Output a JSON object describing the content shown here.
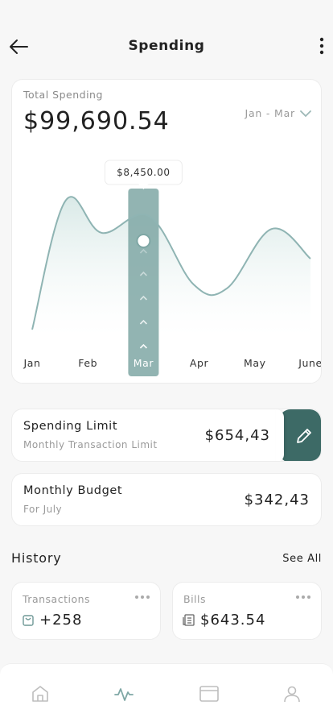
{
  "header": {
    "title": "Spending"
  },
  "summary": {
    "label": "Total Spending",
    "value": "$99,690.54",
    "range": "Jan - Mar"
  },
  "chart_data": {
    "type": "area",
    "categories": [
      "Jan",
      "Feb",
      "Mar",
      "Apr",
      "May",
      "June"
    ],
    "x_index": [
      0,
      0.6,
      1.25,
      2.1,
      2.9,
      3.5,
      4.3,
      5.0
    ],
    "values": [
      0.0,
      1.0,
      0.75,
      0.88,
      0.35,
      0.32,
      0.78,
      0.55
    ],
    "highlight": {
      "category": "Mar",
      "label": "$8,450.00"
    },
    "colors": {
      "line": "#8fb4b3",
      "fill": "#e3efee",
      "highlight": "#7fa7a5"
    }
  },
  "spending_limit": {
    "title": "Spending Limit",
    "subtitle": "Monthly Transaction Limit",
    "amount": "$654,43"
  },
  "monthly_budget": {
    "title": "Monthly Budget",
    "subtitle": "For July",
    "amount": "$342,43"
  },
  "history": {
    "title": "History",
    "see_all": "See All",
    "cards": [
      {
        "label": "Transactions",
        "value": "+258",
        "icon": "bag-icon"
      },
      {
        "label": "Bills",
        "value": "$643.54",
        "icon": "receipt-icon"
      }
    ]
  },
  "tabbar": {
    "items": [
      "home-icon",
      "activity-icon",
      "card-icon",
      "profile-icon"
    ],
    "active": "activity-icon"
  },
  "colors": {
    "accent": "#3d6a66"
  }
}
